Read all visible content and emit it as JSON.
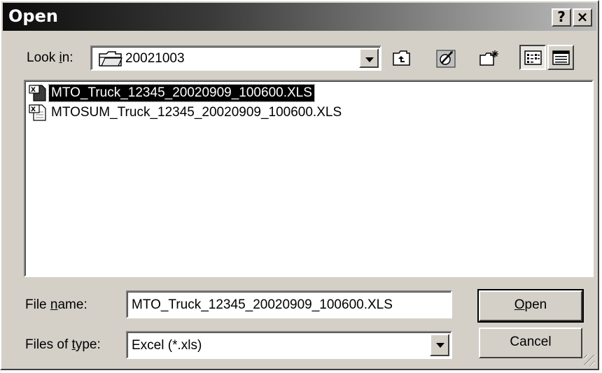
{
  "dialog": {
    "title": "Open",
    "help_button": "?",
    "close_button": "×"
  },
  "lookin": {
    "label_pre": "Look ",
    "label_accel": "i",
    "label_post": "n:",
    "folder": "20021003"
  },
  "toolbar": {
    "icons": [
      "up-one-level-icon",
      "go-to-last-folder-icon",
      "create-new-folder-icon",
      "list-view-icon",
      "details-view-icon"
    ]
  },
  "files": [
    {
      "name": "MTO_Truck_12345_20020909_100600.XLS",
      "selected": true,
      "icon": "excel-file-icon"
    },
    {
      "name": "MTOSUM_Truck_12345_20020909_100600.XLS",
      "selected": false,
      "icon": "excel-file-icon"
    }
  ],
  "filename": {
    "label_pre": "File ",
    "label_accel": "n",
    "label_post": "ame:",
    "value": "MTO_Truck_12345_20020909_100600.XLS"
  },
  "filetype": {
    "label_pre": "Files of ",
    "label_accel": "t",
    "label_post": "ype:",
    "value": "Excel (*.xls)"
  },
  "buttons": {
    "open_accel": "O",
    "open_rest": "pen",
    "cancel": "Cancel"
  }
}
